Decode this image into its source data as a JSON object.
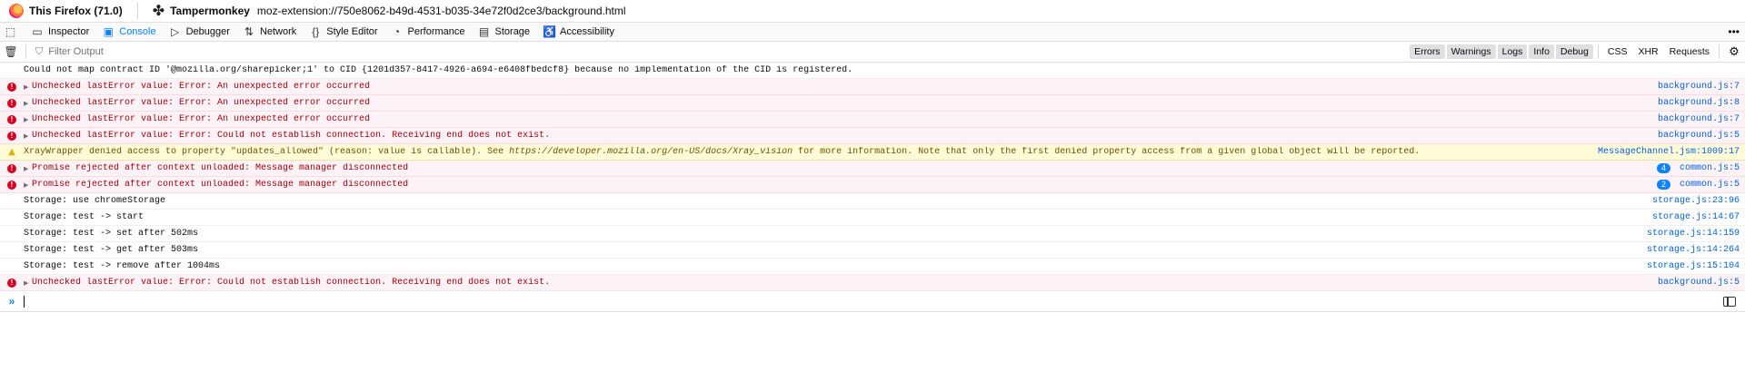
{
  "titlebar": {
    "firefox_label": "This Firefox (71.0)",
    "extension_name": "Tampermonkey",
    "extension_url": "moz-extension://750e8062-b49d-4531-b035-34e72f0d2ce3/background.html"
  },
  "toolbar": {
    "tools": [
      {
        "label": "Inspector",
        "icon": "inspector-icon",
        "glyph": "▭",
        "active": false
      },
      {
        "label": "Console",
        "icon": "console-icon",
        "glyph": "▣",
        "active": true
      },
      {
        "label": "Debugger",
        "icon": "debugger-icon",
        "glyph": "▷",
        "active": false
      },
      {
        "label": "Network",
        "icon": "network-icon",
        "glyph": "⇅",
        "active": false
      },
      {
        "label": "Style Editor",
        "icon": "style-editor-icon",
        "glyph": "{}",
        "active": false
      },
      {
        "label": "Performance",
        "icon": "performance-icon",
        "glyph": "◔",
        "active": false
      },
      {
        "label": "Storage",
        "icon": "storage-icon",
        "glyph": "▤",
        "active": false
      },
      {
        "label": "Accessibility",
        "icon": "accessibility-icon",
        "glyph": "♿",
        "active": false
      }
    ],
    "accent_color": "#0a84ff"
  },
  "filterbar": {
    "placeholder": "Filter Output",
    "level_buttons": [
      {
        "label": "Errors",
        "on": true
      },
      {
        "label": "Warnings",
        "on": true
      },
      {
        "label": "Logs",
        "on": true
      },
      {
        "label": "Info",
        "on": true
      },
      {
        "label": "Debug",
        "on": true
      }
    ],
    "type_buttons": [
      {
        "label": "CSS",
        "on": false
      },
      {
        "label": "XHR",
        "on": false
      },
      {
        "label": "Requests",
        "on": false
      }
    ]
  },
  "messages": [
    {
      "type": "log",
      "text": "Could not map contract ID '@mozilla.org/sharepicker;1' to CID {1201d357-8417-4926-a694-e6408fbedcf8} because no implementation of the CID is registered.",
      "location": "",
      "count": null,
      "expandable": false
    },
    {
      "type": "error",
      "text": "Unchecked lastError value: Error: An unexpected error occurred",
      "location": "background.js:7",
      "count": null,
      "expandable": true
    },
    {
      "type": "error",
      "text": "Unchecked lastError value: Error: An unexpected error occurred",
      "location": "background.js:8",
      "count": null,
      "expandable": true
    },
    {
      "type": "error",
      "text": "Unchecked lastError value: Error: An unexpected error occurred",
      "location": "background.js:7",
      "count": null,
      "expandable": true
    },
    {
      "type": "error",
      "text": "Unchecked lastError value: Error: Could not establish connection. Receiving end does not exist.",
      "location": "background.js:5",
      "count": null,
      "expandable": true
    },
    {
      "type": "warn",
      "text_before": "XrayWrapper denied access to property \"updates_allowed\" (reason: value is callable). See ",
      "link": "https://developer.mozilla.org/en-US/docs/Xray_vision",
      "text_after": " for more information. Note that only the first denied property access from a given global object will be reported.",
      "location": "MessageChannel.jsm:1009:17",
      "count": null,
      "expandable": false
    },
    {
      "type": "error",
      "text": "Promise rejected after context unloaded: Message manager disconnected",
      "location": "common.js:5",
      "count": "4",
      "expandable": true
    },
    {
      "type": "error",
      "text": "Promise rejected after context unloaded: Message manager disconnected",
      "location": "common.js:5",
      "count": "2",
      "expandable": true
    },
    {
      "type": "log",
      "text": "Storage: use chromeStorage",
      "location": "storage.js:23:96",
      "count": null,
      "expandable": false
    },
    {
      "type": "log",
      "text": "Storage: test -> start",
      "location": "storage.js:14:67",
      "count": null,
      "expandable": false
    },
    {
      "type": "log",
      "text": "Storage: test -> set after 502ms",
      "location": "storage.js:14:159",
      "count": null,
      "expandable": false
    },
    {
      "type": "log",
      "text": "Storage: test -> get after 503ms",
      "location": "storage.js:14:264",
      "count": null,
      "expandable": false
    },
    {
      "type": "log",
      "text": "Storage: test -> remove after 1004ms",
      "location": "storage.js:15:104",
      "count": null,
      "expandable": false
    },
    {
      "type": "error",
      "text": "Unchecked lastError value: Error: Could not establish connection. Receiving end does not exist.",
      "location": "background.js:5",
      "count": null,
      "expandable": true
    }
  ],
  "input": {
    "prompt": "»",
    "value": ""
  }
}
